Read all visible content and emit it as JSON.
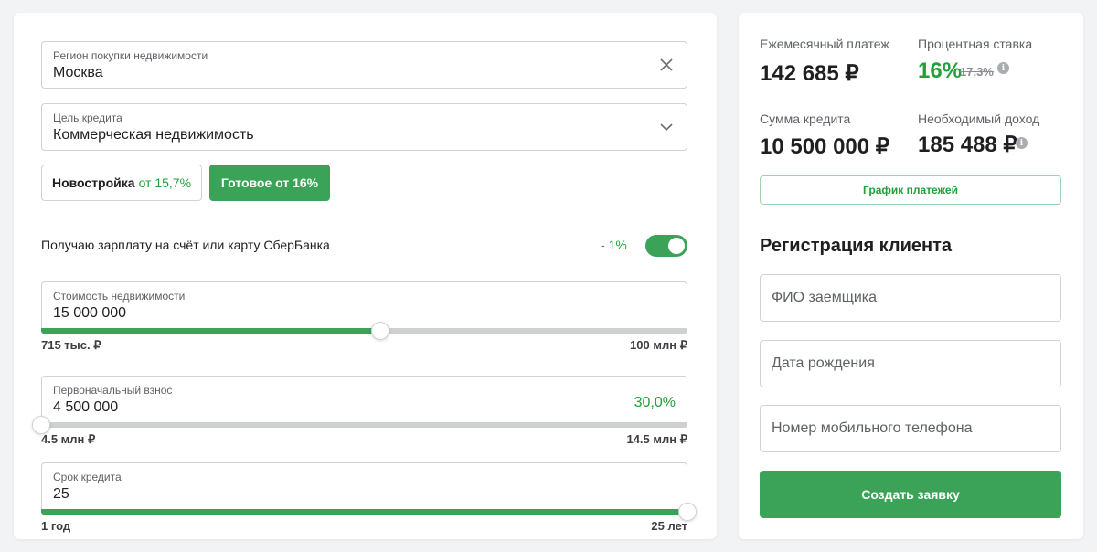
{
  "form": {
    "region": {
      "label": "Регион покупки недвижимости",
      "value": "Москва"
    },
    "purpose": {
      "label": "Цель кредита",
      "value": "Коммерческая недвижимость"
    },
    "options": {
      "new_label": "Новостройка",
      "new_rate": "от 15,7%",
      "ready_label": "Готовое от 16%"
    },
    "salary": {
      "label": "Получаю зарплату на счёт или карту СберБанка",
      "discount": "- 1%",
      "enabled": true
    },
    "property_cost": {
      "label": "Стоимость недвижимости",
      "value": "15 000 000",
      "min_label": "715 тыс. ₽",
      "max_label": "100 млн ₽",
      "level_percent": 52.5
    },
    "down_payment": {
      "label": "Первоначальный взнос",
      "value": "4 500 000",
      "percent": "30,0%",
      "min_label": "4.5 млн ₽",
      "max_label": "14.5 млн ₽",
      "level_percent": 0
    },
    "term": {
      "label": "Срок кредита",
      "value": "25",
      "min_label": "1 год",
      "max_label": "25 лет",
      "level_percent": 100
    }
  },
  "summary": {
    "monthly_label": "Ежемесячный платеж",
    "monthly_value": "142 685 ₽",
    "rate_label": "Процентная ставка",
    "rate_value": "16%",
    "rate_old": "17,3%",
    "loan_label": "Сумма кредита",
    "loan_value": "10 500 000 ₽",
    "income_label": "Необходимый доход",
    "income_value": "185 488 ₽",
    "schedule_button": "График платежей"
  },
  "registration": {
    "title": "Регистрация клиента",
    "name_placeholder": "ФИО заемщика",
    "birth_placeholder": "Дата рождения",
    "phone_placeholder": "Номер мобильного телефона",
    "submit_label": "Создать заявку"
  },
  "colors": {
    "accent": "#3aa357",
    "accent_text": "#21a038",
    "track": "#cfd0d2"
  },
  "icons": {
    "region_clear": "close-icon",
    "purpose_dropdown": "chevron-down-icon",
    "info": "info-icon"
  }
}
